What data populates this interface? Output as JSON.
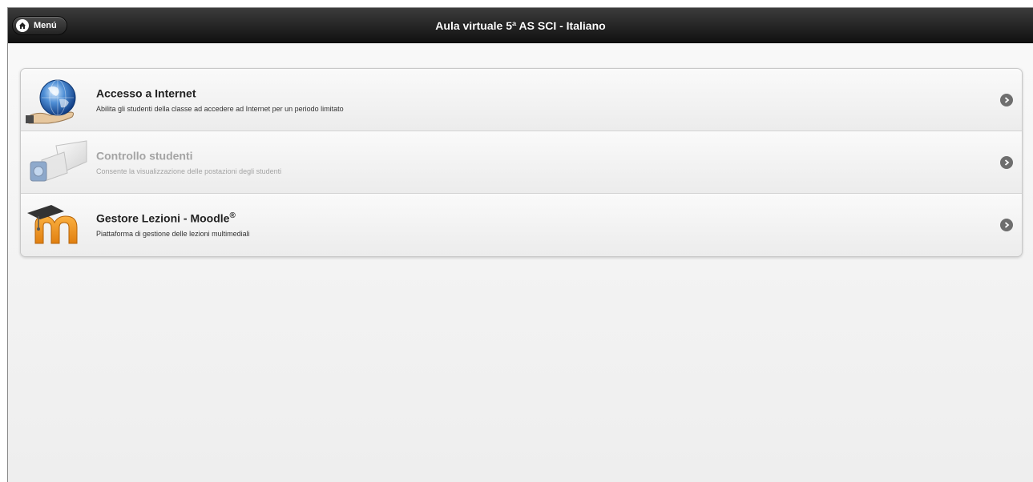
{
  "header": {
    "menu_label": "Menú",
    "title": "Aula virtuale 5ª AS SCI - Italiano"
  },
  "items": [
    {
      "title": "Accesso a Internet",
      "title_sup": "",
      "description": "Abilita gli studenti della classe ad accedere ad Internet per un periodo limitato",
      "icon": "globe-hand-icon",
      "disabled": false
    },
    {
      "title": "Controllo studenti",
      "title_sup": "",
      "description": "Consente la visualizzazione delle postazioni degli studenti",
      "icon": "webcam-icon",
      "disabled": true
    },
    {
      "title": "Gestore Lezioni - Moodle",
      "title_sup": "®",
      "description": "Piattaforma di gestione delle lezioni multimediali",
      "icon": "moodle-logo-icon",
      "disabled": false
    }
  ],
  "colors": {
    "header_bg": "#1a1a1a",
    "page_bg": "#f4f4f4",
    "disabled_text": "#a4a4a4"
  }
}
